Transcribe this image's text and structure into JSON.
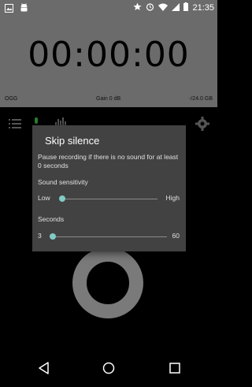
{
  "status_bar": {
    "time": "21:35",
    "left_icons": [
      "image-icon",
      "android-icon"
    ],
    "right_icons": [
      "star-icon",
      "alarm-icon",
      "wifi-icon",
      "signal-icon",
      "battery-icon"
    ]
  },
  "recorder": {
    "timer": "00:00:00",
    "format": "OGG",
    "gain": "Gain 0 dB",
    "level": "-/24.0 GB"
  },
  "toolbar_icons": [
    "list-icon",
    "mic-icon",
    "waveform-icon",
    "settings-icon"
  ],
  "dialog": {
    "title": "Skip silence",
    "message": "Pause recording if there is no sound for at least 0 seconds",
    "sensitivity": {
      "label": "Sound sensitivity",
      "min_label": "Low",
      "max_label": "High",
      "value_fraction": 0.0
    },
    "seconds": {
      "label": "Seconds",
      "min_label": "3",
      "max_label": "60",
      "value_fraction": 0.0
    }
  },
  "nav_bar": [
    "back-icon",
    "home-icon",
    "recents-icon"
  ],
  "colors": {
    "accent": "#80cbc4",
    "dialog_bg": "#424242",
    "dim_panel": "#6b6b6b"
  }
}
